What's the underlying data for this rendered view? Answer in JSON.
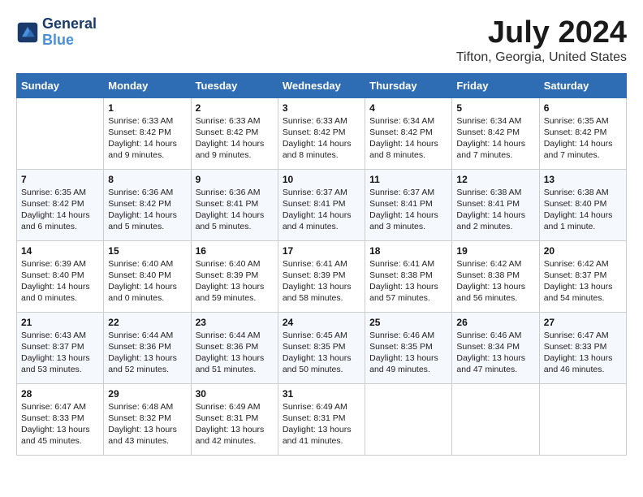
{
  "logo": {
    "line1": "General",
    "line2": "Blue"
  },
  "title": "July 2024",
  "location": "Tifton, Georgia, United States",
  "days_of_week": [
    "Sunday",
    "Monday",
    "Tuesday",
    "Wednesday",
    "Thursday",
    "Friday",
    "Saturday"
  ],
  "weeks": [
    [
      {
        "day": "",
        "info": ""
      },
      {
        "day": "1",
        "info": "Sunrise: 6:33 AM\nSunset: 8:42 PM\nDaylight: 14 hours\nand 9 minutes."
      },
      {
        "day": "2",
        "info": "Sunrise: 6:33 AM\nSunset: 8:42 PM\nDaylight: 14 hours\nand 9 minutes."
      },
      {
        "day": "3",
        "info": "Sunrise: 6:33 AM\nSunset: 8:42 PM\nDaylight: 14 hours\nand 8 minutes."
      },
      {
        "day": "4",
        "info": "Sunrise: 6:34 AM\nSunset: 8:42 PM\nDaylight: 14 hours\nand 8 minutes."
      },
      {
        "day": "5",
        "info": "Sunrise: 6:34 AM\nSunset: 8:42 PM\nDaylight: 14 hours\nand 7 minutes."
      },
      {
        "day": "6",
        "info": "Sunrise: 6:35 AM\nSunset: 8:42 PM\nDaylight: 14 hours\nand 7 minutes."
      }
    ],
    [
      {
        "day": "7",
        "info": "Sunrise: 6:35 AM\nSunset: 8:42 PM\nDaylight: 14 hours\nand 6 minutes."
      },
      {
        "day": "8",
        "info": "Sunrise: 6:36 AM\nSunset: 8:42 PM\nDaylight: 14 hours\nand 5 minutes."
      },
      {
        "day": "9",
        "info": "Sunrise: 6:36 AM\nSunset: 8:41 PM\nDaylight: 14 hours\nand 5 minutes."
      },
      {
        "day": "10",
        "info": "Sunrise: 6:37 AM\nSunset: 8:41 PM\nDaylight: 14 hours\nand 4 minutes."
      },
      {
        "day": "11",
        "info": "Sunrise: 6:37 AM\nSunset: 8:41 PM\nDaylight: 14 hours\nand 3 minutes."
      },
      {
        "day": "12",
        "info": "Sunrise: 6:38 AM\nSunset: 8:41 PM\nDaylight: 14 hours\nand 2 minutes."
      },
      {
        "day": "13",
        "info": "Sunrise: 6:38 AM\nSunset: 8:40 PM\nDaylight: 14 hours\nand 1 minute."
      }
    ],
    [
      {
        "day": "14",
        "info": "Sunrise: 6:39 AM\nSunset: 8:40 PM\nDaylight: 14 hours\nand 0 minutes."
      },
      {
        "day": "15",
        "info": "Sunrise: 6:40 AM\nSunset: 8:40 PM\nDaylight: 14 hours\nand 0 minutes."
      },
      {
        "day": "16",
        "info": "Sunrise: 6:40 AM\nSunset: 8:39 PM\nDaylight: 13 hours\nand 59 minutes."
      },
      {
        "day": "17",
        "info": "Sunrise: 6:41 AM\nSunset: 8:39 PM\nDaylight: 13 hours\nand 58 minutes."
      },
      {
        "day": "18",
        "info": "Sunrise: 6:41 AM\nSunset: 8:38 PM\nDaylight: 13 hours\nand 57 minutes."
      },
      {
        "day": "19",
        "info": "Sunrise: 6:42 AM\nSunset: 8:38 PM\nDaylight: 13 hours\nand 56 minutes."
      },
      {
        "day": "20",
        "info": "Sunrise: 6:42 AM\nSunset: 8:37 PM\nDaylight: 13 hours\nand 54 minutes."
      }
    ],
    [
      {
        "day": "21",
        "info": "Sunrise: 6:43 AM\nSunset: 8:37 PM\nDaylight: 13 hours\nand 53 minutes."
      },
      {
        "day": "22",
        "info": "Sunrise: 6:44 AM\nSunset: 8:36 PM\nDaylight: 13 hours\nand 52 minutes."
      },
      {
        "day": "23",
        "info": "Sunrise: 6:44 AM\nSunset: 8:36 PM\nDaylight: 13 hours\nand 51 minutes."
      },
      {
        "day": "24",
        "info": "Sunrise: 6:45 AM\nSunset: 8:35 PM\nDaylight: 13 hours\nand 50 minutes."
      },
      {
        "day": "25",
        "info": "Sunrise: 6:46 AM\nSunset: 8:35 PM\nDaylight: 13 hours\nand 49 minutes."
      },
      {
        "day": "26",
        "info": "Sunrise: 6:46 AM\nSunset: 8:34 PM\nDaylight: 13 hours\nand 47 minutes."
      },
      {
        "day": "27",
        "info": "Sunrise: 6:47 AM\nSunset: 8:33 PM\nDaylight: 13 hours\nand 46 minutes."
      }
    ],
    [
      {
        "day": "28",
        "info": "Sunrise: 6:47 AM\nSunset: 8:33 PM\nDaylight: 13 hours\nand 45 minutes."
      },
      {
        "day": "29",
        "info": "Sunrise: 6:48 AM\nSunset: 8:32 PM\nDaylight: 13 hours\nand 43 minutes."
      },
      {
        "day": "30",
        "info": "Sunrise: 6:49 AM\nSunset: 8:31 PM\nDaylight: 13 hours\nand 42 minutes."
      },
      {
        "day": "31",
        "info": "Sunrise: 6:49 AM\nSunset: 8:31 PM\nDaylight: 13 hours\nand 41 minutes."
      },
      {
        "day": "",
        "info": ""
      },
      {
        "day": "",
        "info": ""
      },
      {
        "day": "",
        "info": ""
      }
    ]
  ]
}
